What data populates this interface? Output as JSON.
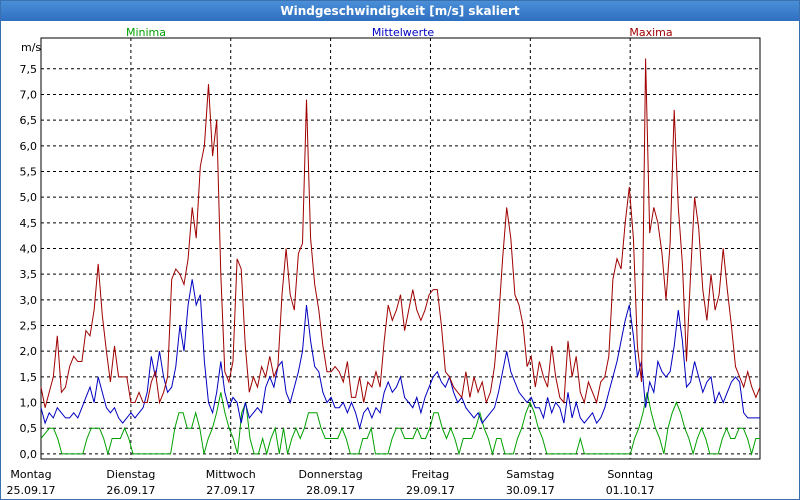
{
  "window": {
    "title": "Windgeschwindigkeit [m/s] skaliert"
  },
  "colors": {
    "minima": "#00a000",
    "mittelwerte": "#0000c0",
    "maxima": "#a00000",
    "grid": "#000000"
  },
  "chart_data": {
    "type": "line",
    "title": "Windgeschwindigkeit [m/s] skaliert",
    "ylabel": "m/s",
    "ylim": [
      -0.1,
      8.1
    ],
    "yticks": [
      "0,0",
      "0,5",
      "1,0",
      "1,5",
      "2,0",
      "2,5",
      "3,0",
      "3,5",
      "4,0",
      "4,5",
      "5,0",
      "5,5",
      "6,0",
      "6,5",
      "7,0",
      "7,5"
    ],
    "grid": true,
    "legend_placement": "top",
    "days": [
      {
        "name": "Montag",
        "date": "25.09.17"
      },
      {
        "name": "Dienstag",
        "date": "26.09.17"
      },
      {
        "name": "Mittwoch",
        "date": "27.09.17"
      },
      {
        "name": "Donnerstag",
        "date": "28.09.17"
      },
      {
        "name": "Freitag",
        "date": "29.09.17"
      },
      {
        "name": "Samstag",
        "date": "30.09.17"
      },
      {
        "name": "Sonntag",
        "date": "01.10.17"
      }
    ],
    "x_start_day": 0.1,
    "x_end_day": 7.3,
    "series": [
      {
        "name": "Minima",
        "key": "minima",
        "values": [
          0.3,
          0.4,
          0.5,
          0.5,
          0.3,
          0.0,
          0.0,
          0.0,
          0.0,
          0.0,
          0.0,
          0.3,
          0.5,
          0.5,
          0.5,
          0.3,
          0.0,
          0.3,
          0.3,
          0.3,
          0.5,
          0.3,
          0.0,
          0.0,
          0.0,
          0.0,
          0.0,
          0.0,
          0.0,
          0.0,
          0.0,
          0.0,
          0.5,
          0.8,
          0.8,
          0.5,
          0.5,
          0.8,
          0.5,
          0.0,
          0.3,
          0.5,
          0.8,
          1.2,
          0.8,
          0.5,
          0.3,
          0.0,
          0.8,
          1.0,
          0.3,
          0.0,
          0.0,
          0.3,
          0.0,
          0.3,
          0.5,
          0.0,
          0.5,
          0.0,
          0.3,
          0.5,
          0.3,
          0.5,
          0.8,
          0.8,
          0.8,
          0.5,
          0.3,
          0.3,
          0.3,
          0.3,
          0.5,
          0.3,
          0.0,
          0.0,
          0.0,
          0.3,
          0.3,
          0.5,
          0.0,
          0.0,
          0.0,
          0.0,
          0.3,
          0.5,
          0.5,
          0.3,
          0.3,
          0.3,
          0.5,
          0.3,
          0.3,
          0.5,
          0.8,
          0.8,
          0.5,
          0.3,
          0.5,
          0.3,
          0.0,
          0.3,
          0.3,
          0.3,
          0.5,
          0.8,
          0.5,
          0.3,
          0.0,
          0.3,
          0.3,
          0.0,
          0.0,
          0.0,
          0.3,
          0.5,
          0.8,
          1.0,
          0.8,
          0.5,
          0.3,
          0.0,
          0.0,
          0.0,
          0.0,
          0.0,
          0.0,
          0.0,
          0.0,
          0.3,
          0.0,
          0.0,
          0.0,
          0.0,
          0.0,
          0.0,
          0.0,
          0.0,
          0.0,
          0.0,
          0.0,
          0.0,
          0.3,
          0.5,
          0.8,
          1.2,
          0.8,
          0.5,
          0.3,
          0.0,
          0.5,
          0.8,
          1.0,
          0.8,
          0.5,
          0.3,
          0.0,
          0.3,
          0.5,
          0.3,
          0.0,
          0.0,
          0.0,
          0.3,
          0.5,
          0.3,
          0.3,
          0.5,
          0.5,
          0.3,
          0.0,
          0.3,
          0.3
        ]
      },
      {
        "name": "Mittelwerte",
        "key": "mittelwerte",
        "values": [
          0.9,
          0.6,
          0.8,
          0.7,
          0.9,
          0.8,
          0.7,
          0.7,
          0.8,
          0.7,
          0.9,
          1.1,
          1.3,
          1.0,
          1.5,
          1.2,
          0.9,
          0.8,
          0.9,
          0.7,
          0.6,
          0.7,
          0.8,
          0.7,
          0.8,
          0.9,
          1.2,
          1.9,
          1.5,
          2.0,
          1.5,
          1.2,
          1.3,
          1.7,
          2.5,
          2.0,
          2.9,
          3.4,
          2.9,
          3.1,
          1.8,
          1.0,
          0.8,
          1.2,
          1.8,
          1.2,
          0.9,
          1.1,
          1.0,
          0.6,
          1.0,
          0.7,
          0.8,
          0.9,
          0.8,
          1.3,
          1.5,
          1.3,
          1.7,
          1.8,
          1.2,
          1.0,
          1.3,
          1.6,
          2.0,
          2.9,
          2.2,
          1.7,
          1.6,
          1.2,
          1.0,
          1.1,
          0.9,
          0.9,
          1.0,
          0.8,
          1.0,
          0.8,
          0.5,
          0.8,
          0.9,
          0.7,
          0.9,
          0.8,
          1.2,
          1.4,
          1.2,
          1.3,
          1.5,
          1.1,
          1.0,
          0.9,
          1.1,
          0.8,
          1.1,
          1.3,
          1.5,
          1.6,
          1.4,
          1.3,
          1.5,
          1.2,
          1.0,
          1.1,
          0.9,
          0.8,
          0.7,
          0.8,
          0.6,
          0.7,
          0.8,
          0.9,
          1.2,
          1.6,
          2.0,
          1.6,
          1.4,
          1.2,
          1.1,
          1.0,
          1.1,
          0.9,
          0.9,
          0.7,
          1.1,
          0.8,
          1.0,
          0.9,
          0.6,
          1.2,
          0.7,
          1.0,
          0.7,
          0.6,
          0.7,
          0.8,
          0.6,
          0.7,
          0.9,
          1.2,
          1.5,
          1.8,
          2.2,
          2.6,
          2.9,
          2.3,
          1.5,
          1.8,
          0.9,
          1.4,
          1.2,
          1.8,
          1.6,
          1.5,
          1.6,
          2.1,
          2.8,
          2.2,
          1.3,
          1.4,
          1.8,
          1.5,
          1.2,
          1.4,
          1.5,
          1.0,
          1.2,
          1.0,
          1.2,
          1.4,
          1.5,
          1.4,
          0.8,
          0.7,
          0.7,
          0.7,
          0.7
        ]
      },
      {
        "name": "Maxima",
        "key": "maxima",
        "values": [
          1.3,
          0.9,
          1.2,
          1.5,
          2.3,
          1.2,
          1.3,
          1.7,
          1.9,
          1.8,
          1.8,
          2.4,
          2.3,
          2.8,
          3.7,
          2.7,
          2.0,
          1.4,
          2.1,
          1.5,
          1.5,
          1.5,
          1.0,
          1.0,
          1.2,
          1.0,
          1.0,
          1.4,
          1.6,
          1.0,
          1.2,
          1.5,
          3.4,
          3.6,
          3.5,
          3.3,
          3.8,
          4.8,
          4.2,
          5.6,
          6.0,
          7.2,
          5.8,
          6.5,
          3.5,
          1.6,
          1.4,
          1.8,
          3.8,
          3.6,
          2.1,
          1.2,
          1.5,
          1.3,
          1.7,
          1.5,
          1.9,
          1.5,
          1.7,
          3.1,
          4.0,
          3.1,
          2.8,
          3.9,
          4.1,
          6.9,
          4.2,
          3.3,
          2.8,
          2.1,
          1.6,
          1.6,
          1.7,
          1.6,
          1.4,
          1.8,
          1.1,
          1.1,
          1.5,
          1.0,
          1.4,
          1.3,
          1.6,
          1.3,
          2.2,
          2.9,
          2.6,
          2.8,
          3.1,
          2.4,
          2.8,
          3.2,
          2.8,
          2.6,
          2.8,
          3.1,
          3.2,
          3.2,
          2.5,
          1.6,
          1.5,
          1.3,
          1.2,
          1.1,
          1.6,
          1.1,
          1.5,
          1.2,
          1.4,
          1.0,
          1.2,
          1.7,
          2.6,
          3.8,
          4.8,
          4.2,
          3.1,
          2.9,
          2.5,
          1.7,
          1.9,
          1.3,
          1.8,
          1.5,
          1.3,
          2.1,
          1.5,
          1.1,
          1.0,
          2.2,
          1.5,
          1.9,
          1.2,
          1.0,
          1.4,
          1.2,
          1.0,
          1.4,
          1.5,
          1.9,
          3.4,
          3.8,
          3.6,
          4.5,
          5.2,
          4.2,
          2.1,
          1.4,
          7.7,
          4.3,
          4.8,
          4.5,
          3.9,
          3.0,
          4.1,
          6.7,
          4.8,
          3.7,
          1.8,
          3.5,
          5.0,
          4.4,
          3.2,
          2.6,
          3.5,
          2.8,
          3.1,
          4.0,
          3.2,
          2.5,
          1.7,
          1.5,
          1.3,
          1.6,
          1.3,
          1.1,
          1.3
        ]
      }
    ]
  }
}
